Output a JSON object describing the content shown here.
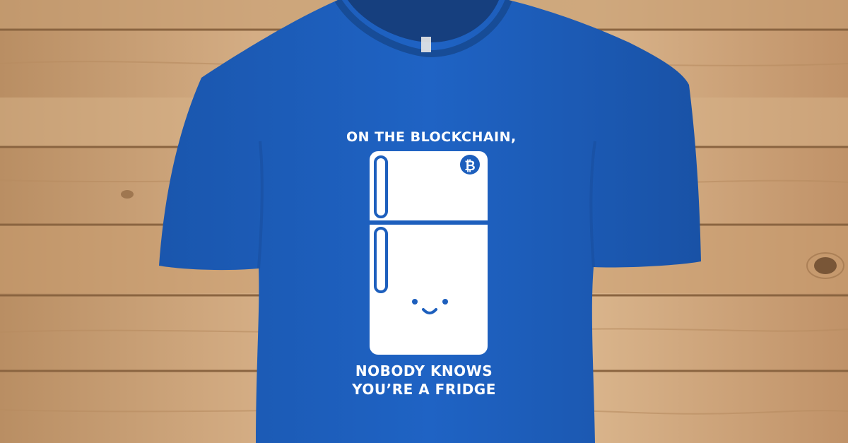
{
  "shirt": {
    "print_lines": {
      "top": "ON THE BLOCKCHAIN,",
      "bottom_line_1": "NOBODY KNOWS",
      "bottom_line_2": "YOU’RE A FRIDGE"
    },
    "badge_symbol": "₿"
  },
  "colors": {
    "shirt": "#1d5fbd",
    "print": "#ffffff",
    "wood": "#cfa67a"
  }
}
